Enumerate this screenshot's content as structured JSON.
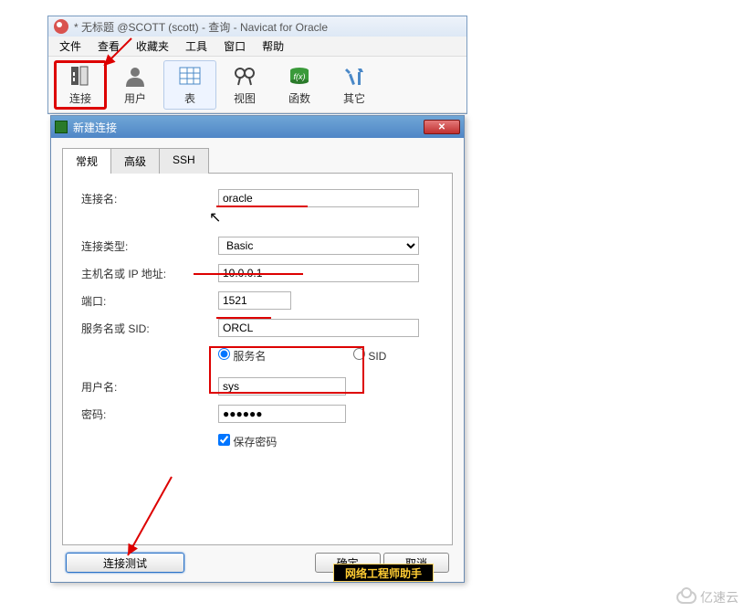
{
  "window": {
    "title": "* 无标题 @SCOTT (scott) - 查询 - Navicat for Oracle"
  },
  "menu": {
    "file": "文件",
    "view": "查看",
    "favorites": "收藏夹",
    "tools": "工具",
    "window": "窗口",
    "help": "帮助"
  },
  "toolbar": {
    "connect": "连接",
    "user": "用户",
    "table": "表",
    "view": "视图",
    "function": "函数",
    "other": "其它"
  },
  "dialog": {
    "title": "新建连接",
    "tabs": {
      "general": "常规",
      "advanced": "高级",
      "ssh": "SSH"
    },
    "labels": {
      "conn_name": "连接名:",
      "conn_type": "连接类型:",
      "host": "主机名或 IP 地址:",
      "port": "端口:",
      "sid": "服务名或 SID:",
      "username": "用户名:",
      "password": "密码:",
      "service_radio": "服务名",
      "sid_radio": "SID",
      "save_pwd": "保存密码"
    },
    "values": {
      "conn_name": "oracle",
      "conn_type": "Basic",
      "host": "10.0.0.1",
      "port": "1521",
      "sid": "ORCL",
      "username": "sys",
      "password": "●●●●●●"
    },
    "buttons": {
      "test": "连接测试",
      "ok": "确定",
      "cancel": "取消"
    }
  },
  "watermark": {
    "banner": "网络工程师助手",
    "brand": "亿速云"
  }
}
